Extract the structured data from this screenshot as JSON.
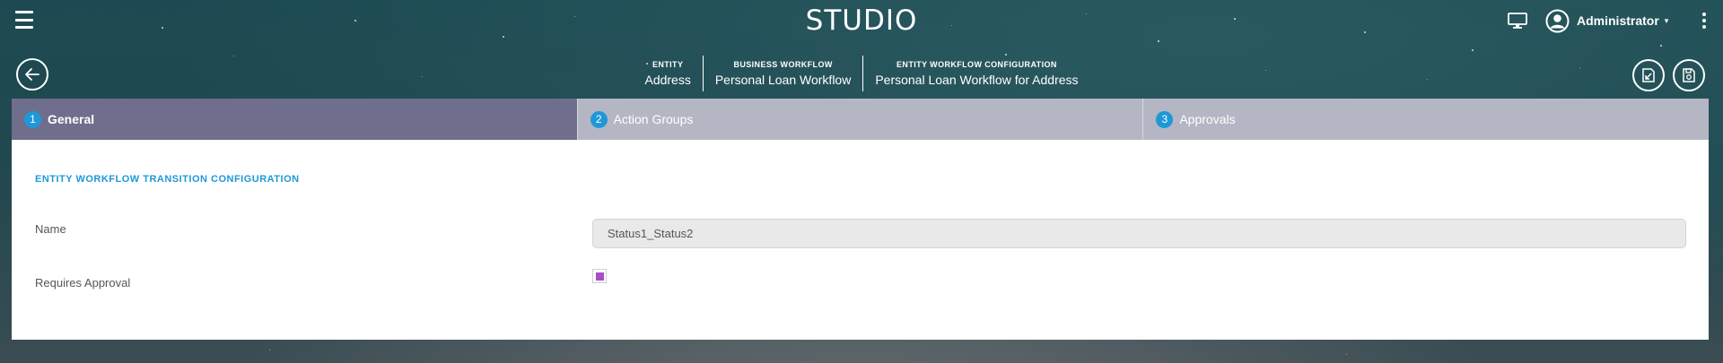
{
  "header": {
    "brand": "STUDIO",
    "user_name": "Administrator",
    "caret": "▾"
  },
  "breadcrumbs": [
    {
      "label": "ENTITY",
      "value": "Address"
    },
    {
      "label": "BUSINESS WORKFLOW",
      "value": "Personal Loan Workflow"
    },
    {
      "label": "ENTITY WORKFLOW CONFIGURATION",
      "value": "Personal Loan Workflow for Address"
    }
  ],
  "tabs": [
    {
      "num": "1",
      "label": "General",
      "active": true
    },
    {
      "num": "2",
      "label": "Action Groups",
      "active": false
    },
    {
      "num": "3",
      "label": "Approvals",
      "active": false
    }
  ],
  "form": {
    "section_title": "ENTITY WORKFLOW TRANSITION CONFIGURATION",
    "name_label": "Name",
    "name_value": "Status1_Status2",
    "requires_approval_label": "Requires Approval",
    "requires_approval_checked": true
  },
  "colors": {
    "accent": "#1f98d8",
    "tab_active": "#6f6e8c",
    "tab_inactive": "#b4b6c4",
    "checkbox_fill": "#a84fc4"
  },
  "icons": {
    "menu": "hamburger-icon",
    "monitor": "monitor-icon",
    "user": "user-circle-icon",
    "more": "kebab-icon",
    "back": "arrow-left-icon",
    "export": "export-icon",
    "save": "save-icon"
  }
}
